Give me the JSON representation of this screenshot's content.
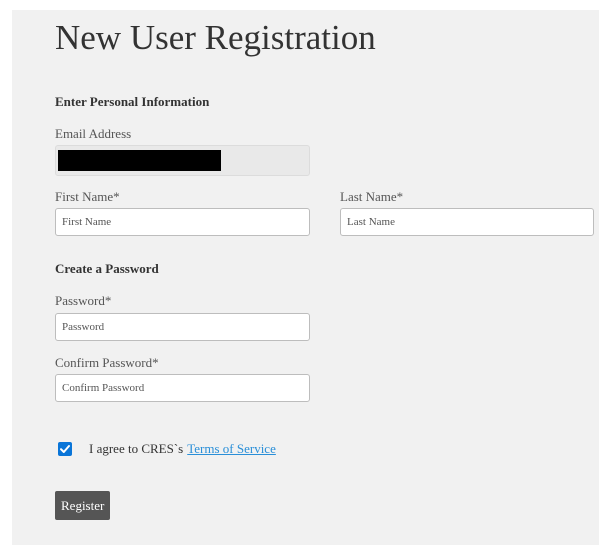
{
  "page": {
    "title": "New User Registration"
  },
  "personal": {
    "heading": "Enter Personal Information",
    "email_label": "Email Address",
    "first_name_label": "First Name*",
    "first_name_placeholder": "First Name",
    "last_name_label": "Last Name*",
    "last_name_placeholder": "Last Name"
  },
  "password": {
    "heading": "Create a Password",
    "password_label": "Password*",
    "password_placeholder": "Password",
    "confirm_label": "Confirm Password*",
    "confirm_placeholder": "Confirm Password"
  },
  "agreement": {
    "checked": true,
    "text": "I agree to CRES`s",
    "link_text": "Terms of Service"
  },
  "actions": {
    "register_label": "Register"
  },
  "colors": {
    "panel_background": "#f1f1f1",
    "checkbox_accent": "#0a75d8",
    "link": "#2a8fd8",
    "button_background": "#555555"
  },
  "icons": {
    "checkbox": "checkmark-icon"
  }
}
